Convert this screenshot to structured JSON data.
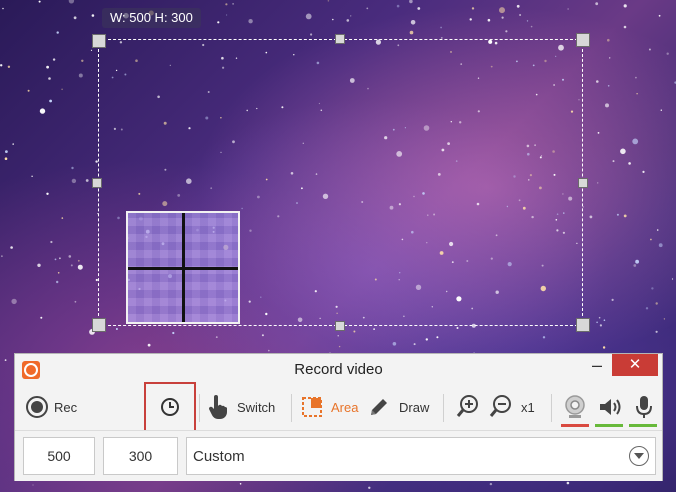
{
  "overlay": {
    "dimension_text": "W: 500 H: 300"
  },
  "recorder": {
    "title": "Record video",
    "minimize_label": "–",
    "close_label": "✕",
    "toolbar": {
      "rec_label": "Rec",
      "switch_label": "Switch",
      "area_label": "Area",
      "draw_label": "Draw",
      "zoom_level": "x1"
    },
    "icons": {
      "rec": "record-icon",
      "timer": "clock-icon",
      "switch": "hand-pointer-icon",
      "area": "area-select-icon",
      "draw": "pencil-icon",
      "zoom_in": "zoom-in-icon",
      "zoom_out": "zoom-out-icon",
      "webcam": "webcam-icon",
      "speaker": "speaker-icon",
      "microphone": "microphone-icon"
    },
    "width_value": "500",
    "height_value": "300",
    "preset_value": "Custom",
    "colors": {
      "accent": "#f06a2a",
      "close": "#c93c36",
      "webcam_status": "#d94a40",
      "audio_status": "#67b93a",
      "highlight_box": "#c8403b"
    }
  }
}
